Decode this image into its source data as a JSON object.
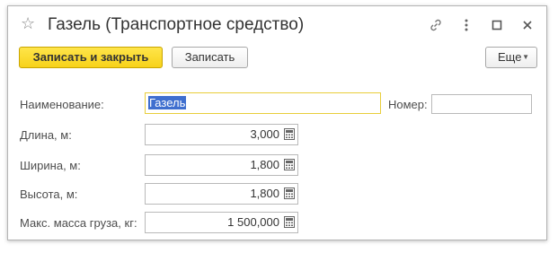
{
  "window": {
    "title": "Газель (Транспортное средство)"
  },
  "toolbar": {
    "save_close_label": "Записать и закрыть",
    "save_label": "Записать",
    "more_label": "Еще"
  },
  "form": {
    "name_label": "Наименование:",
    "name_value": "Газель",
    "number_label": "Номер:",
    "number_value": "",
    "length_label": "Длина, м:",
    "length_value": "3,000",
    "width_label": "Ширина, м:",
    "width_value": "1,800",
    "height_label": "Высота, м:",
    "height_value": "1,800",
    "max_mass_label": "Макс. масса груза, кг:",
    "max_mass_value": "1 500,000"
  },
  "colors": {
    "primary_button": "#f7d21a",
    "focus_border": "#e8cd3a",
    "selection": "#3f6fcf"
  },
  "icons": {
    "favorite": "star-icon",
    "link": "link-icon",
    "menu": "more-vertical-icon",
    "maximize": "maximize-icon",
    "close": "close-icon",
    "calculator": "calculator-icon"
  }
}
